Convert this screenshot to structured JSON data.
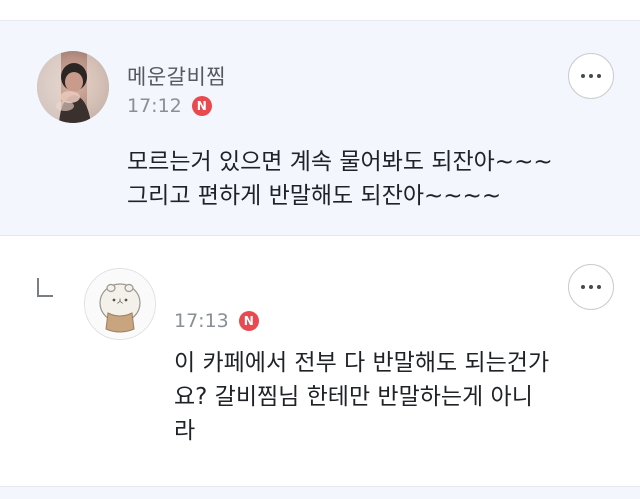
{
  "comments": [
    {
      "author": "메운갈비찜",
      "time": "17:12",
      "badge": "N",
      "text_lines": [
        "모르는거 있으면 계속 물어봐도 되잔아~~~",
        "그리고 편하게 반말해도 되잔아~~~~"
      ]
    },
    {
      "time": "17:13",
      "badge": "N",
      "text_lines": [
        "이 카페에서 전부 다 반말해도 되는건가",
        "요? 갈비찜님 한테만 반말하는게 아니",
        "라"
      ]
    }
  ],
  "colors": {
    "highlight_bg": "#f3f6fc",
    "badge": "#e84a4f",
    "meta_text": "#8a8f96"
  },
  "icons": [
    "more-horizontal-icon",
    "reply-arrow-icon",
    "new-badge-icon"
  ]
}
